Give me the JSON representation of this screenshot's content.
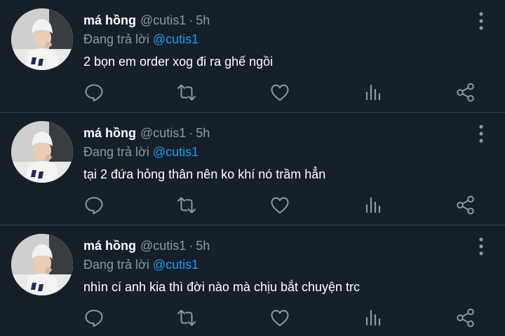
{
  "colors": {
    "background": "#15202b",
    "divider": "#38444d",
    "secondary_text": "#8b98a5",
    "accent": "#1d9bf0"
  },
  "icons": [
    "avatar",
    "more-icon",
    "reply-icon",
    "retweet-icon",
    "like-icon",
    "views-icon",
    "share-icon"
  ],
  "tweets": [
    {
      "name": "má hồng",
      "handle": "@cutis1",
      "dot": "·",
      "time": "5h",
      "replying_prefix": "Đang trả lời",
      "replying_to": "@cutis1",
      "text": "2 bọn em order xog đi ra ghế ngồi"
    },
    {
      "name": "má hồng",
      "handle": "@cutis1",
      "dot": "·",
      "time": "5h",
      "replying_prefix": "Đang trả lời",
      "replying_to": "@cutis1",
      "text": "tại 2 đứa hỏng thân nên ko khí nó trầm hẳn"
    },
    {
      "name": "má hồng",
      "handle": "@cutis1",
      "dot": "·",
      "time": "5h",
      "replying_prefix": "Đang trả lời",
      "replying_to": "@cutis1",
      "text": "nhìn cí anh kia thì đời nào mà chịu bắt chuyện trc"
    }
  ]
}
